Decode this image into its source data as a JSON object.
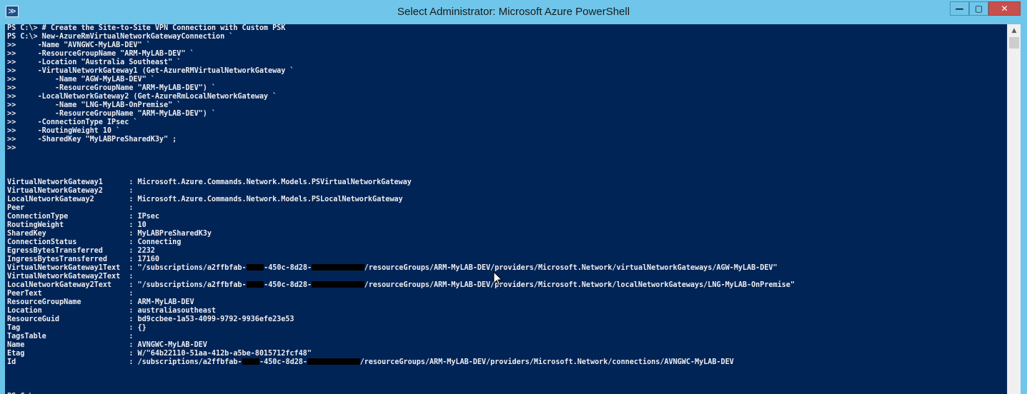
{
  "window": {
    "title": "Select Administrator: Microsoft Azure PowerShell",
    "minimize_glyph": "—",
    "maximize_glyph": "▢",
    "close_glyph": "✕",
    "icon_glyph": "≫"
  },
  "scrollbar": {
    "up_glyph": "▲"
  },
  "console": {
    "lines": [
      "PS C:\\> # Create the Site-to-Site VPN Connection with Custom PSK",
      "PS C:\\> New-AzureRmVirtualNetworkGatewayConnection `",
      ">>     -Name \"AVNGWC-MyLAB-DEV\" `",
      ">>     -ResourceGroupName \"ARM-MyLAB-DEV\" `",
      ">>     -Location \"Australia Southeast\" `",
      ">>     -VirtualNetworkGateway1 (Get-AzureRMVirtualNetworkGateway `",
      ">>         -Name \"AGW-MyLAB-DEV\" `",
      ">>         -ResourceGroupName \"ARM-MyLAB-DEV\") `",
      ">>     -LocalNetworkGateway2 (Get-AzureRmLocalNetworkGateway `",
      ">>         -Name \"LNG-MyLAB-OnPremise\" `",
      ">>         -ResourceGroupName \"ARM-MyLAB-DEV\") `",
      ">>     -ConnectionType IPsec `",
      ">>     -RoutingWeight 10 `",
      ">>     -SharedKey \"MyLABPreSharedK3y\" ;",
      ">>",
      "",
      "",
      "",
      "VirtualNetworkGateway1      : Microsoft.Azure.Commands.Network.Models.PSVirtualNetworkGateway",
      "VirtualNetworkGateway2      :",
      "LocalNetworkGateway2        : Microsoft.Azure.Commands.Network.Models.PSLocalNetworkGateway",
      "Peer                        :",
      "ConnectionType              : IPsec",
      "RoutingWeight               : 10",
      "SharedKey                   : MyLABPreSharedK3y",
      "ConnectionStatus            : Connecting",
      "EgressBytesTransferred      : 2232",
      "IngressBytesTransferred     : 17160",
      {
        "pre": "VirtualNetworkGateway1Text  : \"/subscriptions/a2ffbfab-",
        "mid": "-450c-8d28-",
        "post": "/resourceGroups/ARM-MyLAB-DEV/providers/Microsoft.Network/virtualNetworkGateways/AGW-MyLAB-DEV\"",
        "redact2_width": 12
      },
      "VirtualNetworkGateway2Text  :",
      {
        "pre": "LocalNetworkGateway2Text    : \"/subscriptions/a2ffbfab-",
        "mid": "-450c-8d28-",
        "post": "/resourceGroups/ARM-MyLAB-DEV/providers/Microsoft.Network/localNetworkGateways/LNG-MyLAB-OnPremise\"",
        "redact2_width": 12
      },
      "PeerText                    :",
      "ResourceGroupName           : ARM-MyLAB-DEV",
      "Location                    : australiasoutheast",
      "ResourceGuid                : bd9ccbee-1a53-4099-9792-9936efe23e53",
      "Tag                         : {}",
      "TagsTable                   :",
      "Name                        : AVNGWC-MyLAB-DEV",
      "Etag                        : W/\"64b22110-51aa-412b-a5be-8015712fcf48\"",
      {
        "pre": "Id                          : /subscriptions/a2ffbfab-",
        "mid": "-450c-8d28-",
        "post": "/resourceGroups/ARM-MyLAB-DEV/providers/Microsoft.Network/connections/AVNGWC-MyLAB-DEV",
        "redact2_width": 12
      },
      "",
      "",
      "",
      {
        "prompt": "PS C:\\> "
      }
    ]
  }
}
